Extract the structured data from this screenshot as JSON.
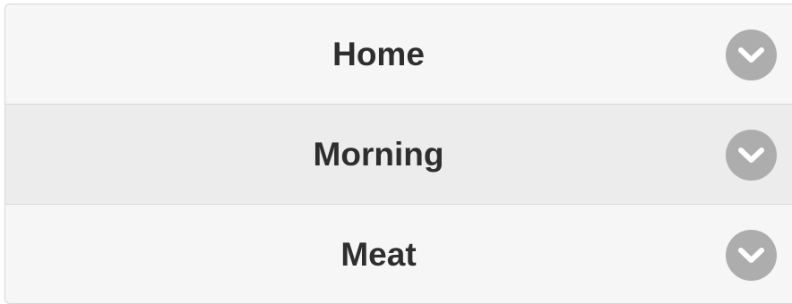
{
  "menu": {
    "items": [
      {
        "label": "Home",
        "icon": "chevron-down-icon"
      },
      {
        "label": "Morning",
        "icon": "chevron-down-icon"
      },
      {
        "label": "Meat",
        "icon": "chevron-down-icon"
      }
    ]
  },
  "colors": {
    "row_background": "#f6f6f6",
    "row_active_background": "#ececec",
    "text": "#2e2e2e",
    "icon_circle": "#adadad",
    "icon_glyph": "#ffffff"
  }
}
